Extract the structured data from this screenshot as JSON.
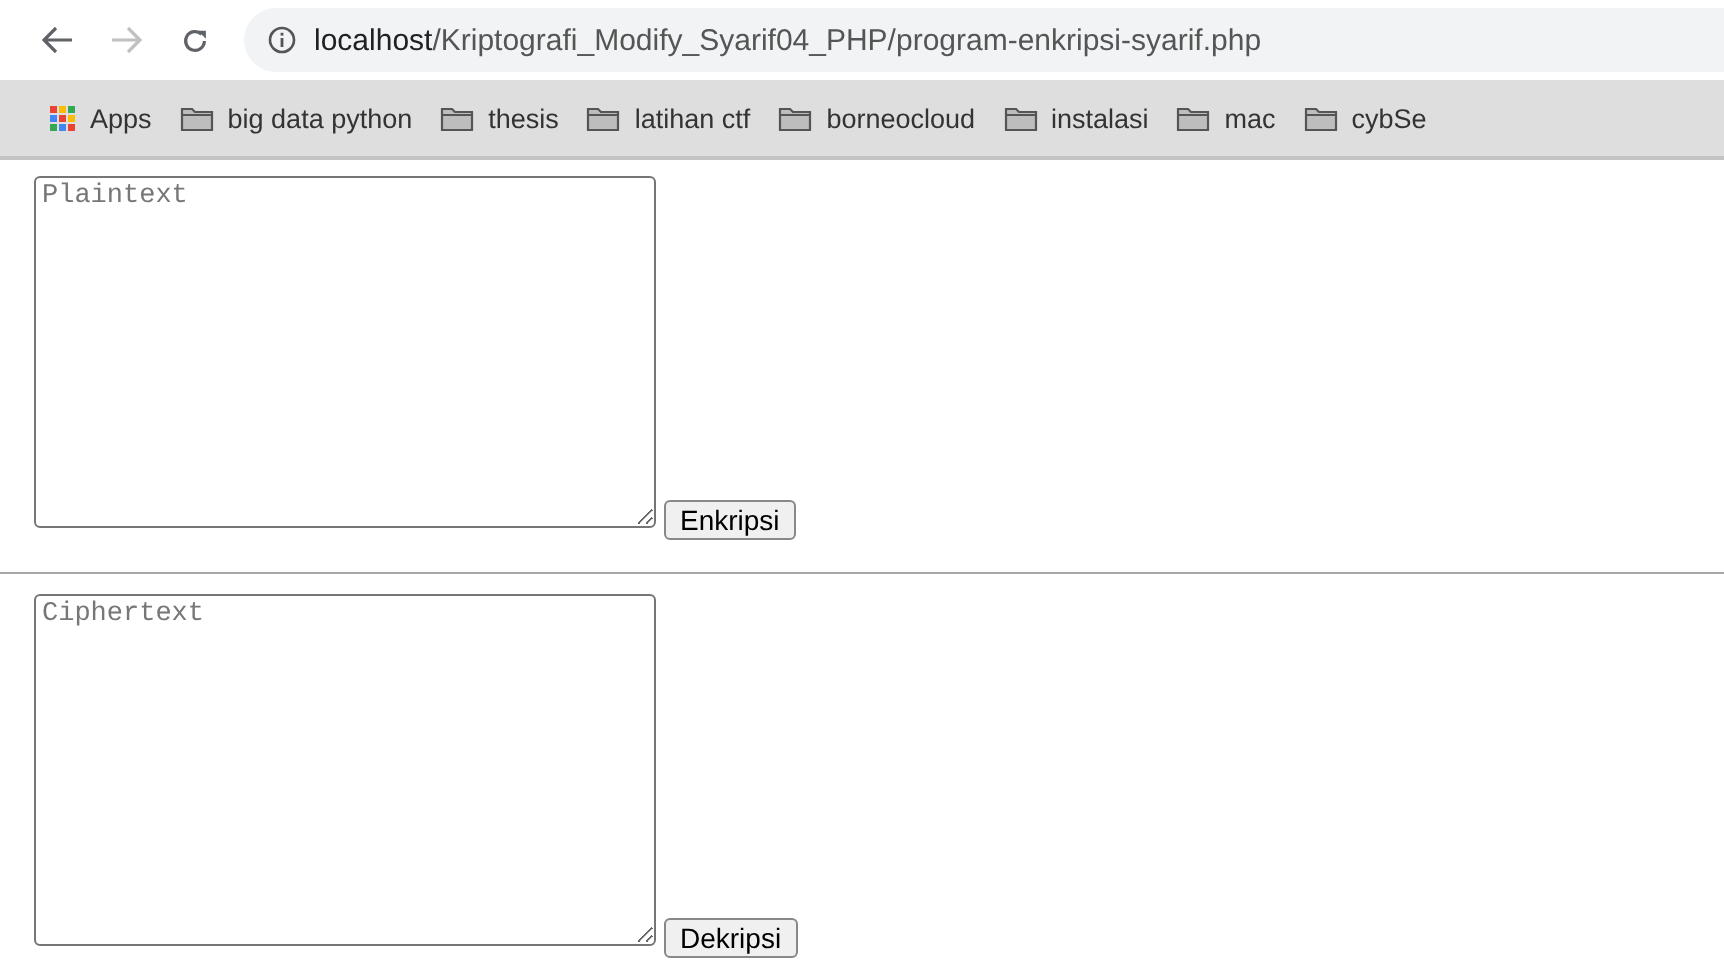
{
  "browser": {
    "nav": [
      {
        "kind": "back",
        "disabled": false
      },
      {
        "kind": "forward",
        "disabled": true
      },
      {
        "kind": "reload",
        "disabled": false
      }
    ],
    "address": "**localhost**/Kriptografi_Modify_Syarif04_PHP/program-enkripsi-syarif.php",
    "bookmarks": [
      {
        "kind": "apps",
        "label": "Apps"
      },
      {
        "kind": "folder",
        "label": "big data python"
      },
      {
        "kind": "folder",
        "label": "thesis"
      },
      {
        "kind": "folder",
        "label": "latihan ctf"
      },
      {
        "kind": "folder",
        "label": "borneocloud"
      },
      {
        "kind": "folder",
        "label": "instalasi"
      },
      {
        "kind": "folder",
        "label": "mac"
      },
      {
        "kind": "folder",
        "label": "cybSe"
      }
    ]
  },
  "forms": [
    {
      "placeholder": "Plaintext",
      "button": "Enkripsi"
    },
    {
      "placeholder": "Ciphertext",
      "button": "Dekripsi"
    }
  ]
}
